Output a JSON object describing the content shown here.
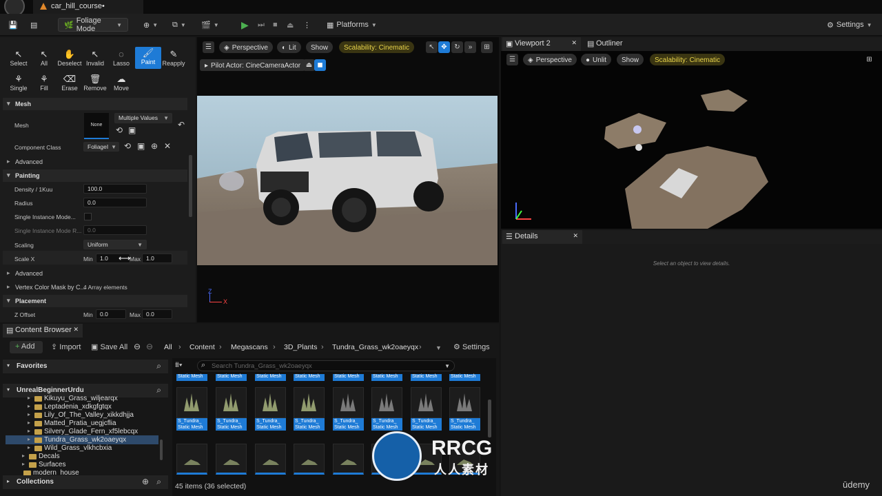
{
  "window": {
    "tab_title": "car_hill_course•"
  },
  "toolbar": {
    "mode": "Foliage Mode",
    "platforms": "Platforms",
    "settings": "Settings"
  },
  "foliage_tools": {
    "row1": [
      "Select",
      "All",
      "Deselect",
      "Invalid",
      "Lasso",
      "Paint",
      "Reapply"
    ],
    "row2": [
      "Single",
      "Fill",
      "Erase",
      "Remove",
      "Move"
    ],
    "active": "Paint"
  },
  "details_left": {
    "mesh_section": "Mesh",
    "mesh_label": "Mesh",
    "mesh_thumb": "None",
    "mesh_value": "Multiple Values",
    "component_class_label": "Component Class",
    "component_class_value": "FoliageI",
    "advanced1": "Advanced",
    "painting_section": "Painting",
    "density_label": "Density / 1Kuu",
    "density_value": "100.0",
    "radius_label": "Radius",
    "radius_value": "0.0",
    "single_instance_label": "Single Instance Mode...",
    "single_instance_r_label": "Single Instance Mode R...",
    "single_instance_r_value": "0.0",
    "scaling_label": "Scaling",
    "scaling_value": "Uniform",
    "scalex_label": "Scale X",
    "scalex_min_label": "Min",
    "scalex_min": "1.0",
    "scalex_max_label": "Max",
    "scalex_max": "1.0",
    "advanced2": "Advanced",
    "vertex_label": "Vertex Color Mask by C...",
    "vertex_value": "4 Array elements",
    "placement_section": "Placement",
    "zoffset_label": "Z Offset",
    "zoffset_min_label": "Min",
    "zoffset_min": "0.0",
    "zoffset_max_label": "Max",
    "zoffset_max": "0.0"
  },
  "viewport1": {
    "perspective": "Perspective",
    "lit": "Lit",
    "show": "Show",
    "scalability": "Scalability: Cinematic",
    "pilot": "Pilot Actor: CineCameraActor",
    "axis_z": "Z",
    "axis_x": "X"
  },
  "viewport2": {
    "tab": "Viewport 2",
    "outliner": "Outliner",
    "perspective": "Perspective",
    "unlit": "Unlit",
    "show": "Show",
    "scalability": "Scalability: Cinematic"
  },
  "details": {
    "tab": "Details",
    "empty": "Select an object to view details."
  },
  "content_browser": {
    "tab": "Content Browser",
    "add": "Add",
    "import": "Import",
    "save_all": "Save All",
    "breadcrumbs": [
      "All",
      "Content",
      "Megascans",
      "3D_Plants",
      "Tundra_Grass_wk2oaeyqx"
    ],
    "settings": "Settings",
    "favorites": "Favorites",
    "project": "UnrealBeginnerUrdu",
    "search_placeholder": "Search Tundra_Grass_wk2oaeyqx",
    "folders": [
      "Kikuyu_Grass_wiljearqx",
      "Leptadenia_xdkgfgtqx",
      "Lily_Of_The_Valley_xikkdhjja",
      "Matted_Pratia_uegjcflia",
      "Silvery_Glade_Fern_xf5lebcqx",
      "Tundra_Grass_wk2oaeyqx",
      "Wild_Grass_vlkhcbxia",
      "Decals",
      "Surfaces",
      "modern_house"
    ],
    "collections": "Collections",
    "asset_type": "Static Mesh",
    "asset_name": "S_Tundra_",
    "status": "45 items (36 selected)"
  },
  "watermark": {
    "brand": "RRCG",
    "sub": "人人素材",
    "udemy": "ūdemy"
  }
}
